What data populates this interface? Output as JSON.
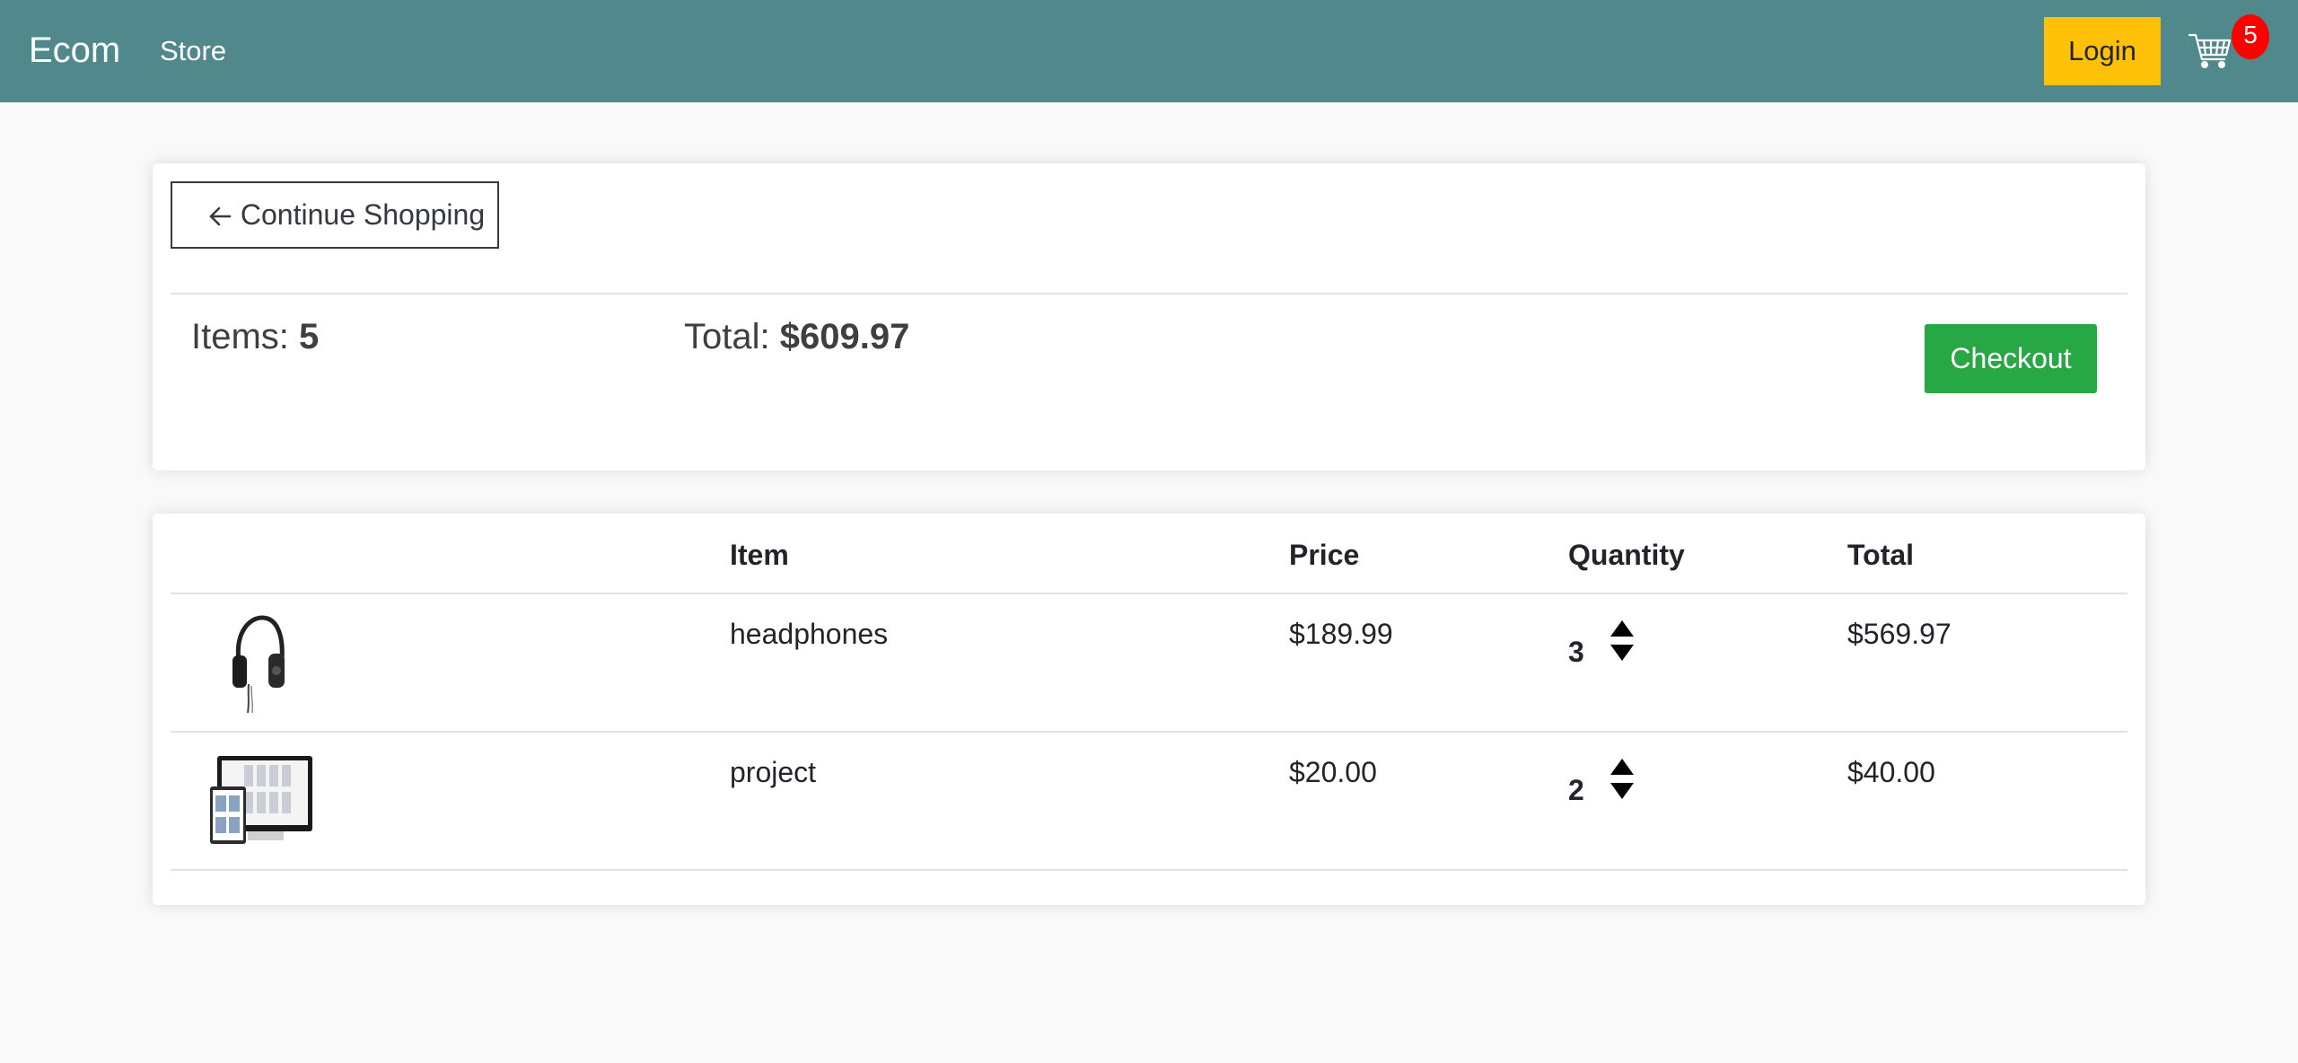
{
  "navbar": {
    "brand": "Ecom",
    "store_link": "Store",
    "login_label": "Login",
    "cart_icon": "cart-icon",
    "cart_count": "5",
    "bg_color": "#51888c",
    "login_color": "#ffc107",
    "badge_color": "#ff0000"
  },
  "summary": {
    "continue_label": "Continue Shopping",
    "continue_icon": "arrow-left-icon",
    "items_label": "Items:",
    "items_value": "5",
    "total_label": "Total:",
    "total_value": "$609.97",
    "checkout_label": "Checkout",
    "checkout_color": "#28a745"
  },
  "cart_table": {
    "columns": [
      "",
      "Item",
      "Price",
      "Quantity",
      "Total"
    ],
    "rows": [
      {
        "image": "headphones-image",
        "name": "headphones",
        "price": "$189.99",
        "quantity": "3",
        "total": "$569.97"
      },
      {
        "image": "project-image",
        "name": "project",
        "price": "$20.00",
        "quantity": "2",
        "total": "$40.00"
      }
    ]
  }
}
